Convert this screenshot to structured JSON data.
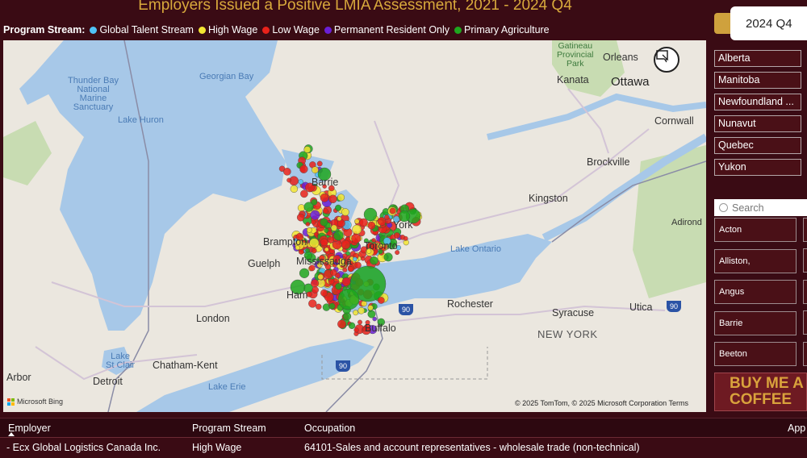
{
  "title": "Employers Issued a Positive LMIA Assessment, 2021 - 2024 Q4",
  "legend": {
    "label": "Program Stream:",
    "items": [
      {
        "label": "Global Talent Stream",
        "color": "#4fc3f7"
      },
      {
        "label": "High Wage",
        "color": "#f3e532"
      },
      {
        "label": "Low Wage",
        "color": "#e8221b"
      },
      {
        "label": "Permanent Resident Only",
        "color": "#6a1fd6"
      },
      {
        "label": "Primary Agriculture",
        "color": "#1ea61e"
      }
    ]
  },
  "quarter": {
    "selected": "2024 Q4"
  },
  "provinces": [
    "Alberta",
    "Manitoba",
    "Newfoundland ...",
    "Nunavut",
    "Quebec",
    "Yukon"
  ],
  "search": {
    "placeholder": "Search"
  },
  "cities": [
    "Acton",
    "Alliston,",
    "Angus",
    "Barrie",
    "Beeton"
  ],
  "coffee": {
    "line1": "BUY ME A",
    "line2": "COFFEE"
  },
  "map": {
    "labels": {
      "georgian_bay": "Georgian Bay",
      "thunder_bay": "Thunder Bay\nNational\nMarine\nSanctuary",
      "lake_huron": "Lake Huron",
      "gatineau": "Gatineau\nProvincial\nPark",
      "orleans": "Orleans",
      "kanata": "Kanata",
      "ottawa": "Ottawa",
      "cornwall": "Cornwall",
      "brockville": "Brockville",
      "barrie": "Barrie",
      "kingston": "Kingston",
      "adirondack": "Adirond",
      "brampton": "Brampton",
      "toronto": "Toronto",
      "york": "York",
      "guelph": "Guelph",
      "mississauga": "Mississauga",
      "lake_ontario": "Lake Ontario",
      "hamilton": "Ham",
      "rochester": "Rochester",
      "syracuse": "Syracuse",
      "utica": "Utica",
      "new_york": "NEW YORK",
      "london": "London",
      "buffalo": "Buffalo",
      "lake_st_clair": "Lake\nSt Clair",
      "chatham": "Chatham-Kent",
      "arbor": "Arbor",
      "detroit": "Detroit",
      "lake_erie": "Lake Erie"
    },
    "shields": [
      "90",
      "90",
      "90"
    ],
    "bing": "Microsoft Bing",
    "copyright": "© 2025 TomTom, © 2025 Microsoft Corporation  Terms"
  },
  "table": {
    "columns": [
      "Employer",
      "Program Stream",
      "Occupation",
      "App"
    ],
    "rows": [
      {
        "employer": "- Ecx Global Logistics Canada Inc.",
        "stream": "High Wage",
        "occupation": "64101-Sales and account representatives - wholesale trade (non-technical)"
      }
    ]
  }
}
